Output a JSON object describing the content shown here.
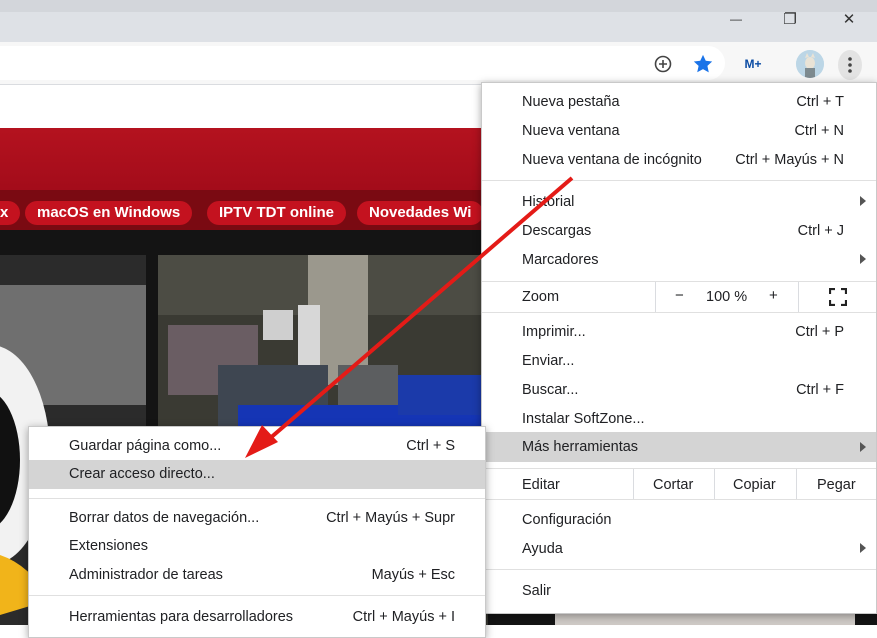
{
  "window": {
    "minimize_glyph": "—",
    "restore_glyph": "❐",
    "close_glyph": "✕"
  },
  "toolbar": {
    "icons": [
      "add-circle-icon",
      "bookmark-star-icon",
      "movistar-extension-icon",
      "avatar",
      "kebab-menu-icon"
    ],
    "star_color": "#1a73e8",
    "extension_label": "M+"
  },
  "page": {
    "banner_color": "#b10d1d",
    "tags": [
      "x",
      "macOS en Windows",
      "IPTV TDT online",
      "Novedades Wi"
    ]
  },
  "chrome_menu": {
    "group1": [
      {
        "label": "Nueva pestaña",
        "shortcut": "Ctrl + T"
      },
      {
        "label": "Nueva ventana",
        "shortcut": "Ctrl + N"
      },
      {
        "label": "Nueva ventana de incógnito",
        "shortcut": "Ctrl + Mayús + N"
      }
    ],
    "group2": [
      {
        "label": "Historial",
        "shortcut": ""
      },
      {
        "label": "Descargas",
        "shortcut": "Ctrl + J"
      },
      {
        "label": "Marcadores",
        "shortcut": ""
      }
    ],
    "zoom": {
      "label": "Zoom",
      "minus": "−",
      "value": "100 %",
      "plus": "+"
    },
    "group3": [
      {
        "label": "Imprimir...",
        "shortcut": "Ctrl + P"
      },
      {
        "label": "Enviar...",
        "shortcut": ""
      },
      {
        "label": "Buscar...",
        "shortcut": "Ctrl + F"
      },
      {
        "label": "Instalar SoftZone...",
        "shortcut": ""
      },
      {
        "label": "Más herramientas",
        "shortcut": ""
      }
    ],
    "edit": {
      "label": "Editar",
      "cut": "Cortar",
      "copy": "Copiar",
      "paste": "Pegar"
    },
    "group4": [
      {
        "label": "Configuración"
      },
      {
        "label": "Ayuda"
      }
    ],
    "exit": {
      "label": "Salir"
    }
  },
  "more_tools_menu": [
    {
      "label": "Guardar página como...",
      "shortcut": "Ctrl + S"
    },
    {
      "label": "Crear acceso directo...",
      "shortcut": ""
    },
    {
      "label": "Borrar datos de navegación...",
      "shortcut": "Ctrl + Mayús + Supr"
    },
    {
      "label": "Extensiones",
      "shortcut": ""
    },
    {
      "label": "Administrador de tareas",
      "shortcut": "Mayús + Esc"
    },
    {
      "label": "Herramientas para desarrolladores",
      "shortcut": "Ctrl + Mayús + I"
    }
  ],
  "annotation": {
    "arrow_color": "#e41b17"
  }
}
